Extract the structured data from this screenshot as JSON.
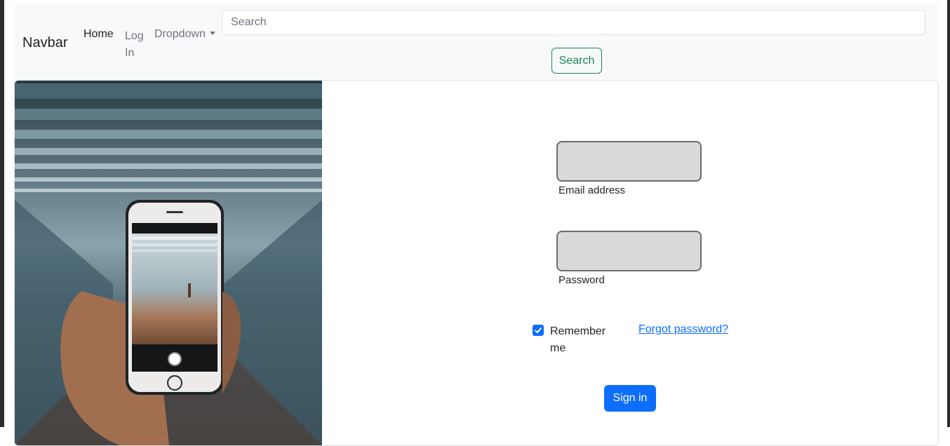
{
  "navbar": {
    "brand": "Navbar",
    "links": [
      {
        "label": "Home",
        "active": true
      },
      {
        "label": "Log In",
        "active": false
      },
      {
        "label": "Dropdown",
        "active": false
      }
    ],
    "search": {
      "placeholder": "Search",
      "value": ""
    },
    "search_button": "Search"
  },
  "login_form": {
    "email_label": "Email address",
    "password_label": "Password",
    "remember_label": "Remember me",
    "remember_checked": true,
    "forgot_link": "Forgot password?",
    "submit_label": "Sign in"
  },
  "colors": {
    "primary": "#0d6efd",
    "success": "#198754",
    "navbar_bg": "#f8f9fa",
    "field_bg": "#d9d9d9"
  },
  "icons": [
    "checkbox-check-icon",
    "dropdown-caret-icon"
  ]
}
